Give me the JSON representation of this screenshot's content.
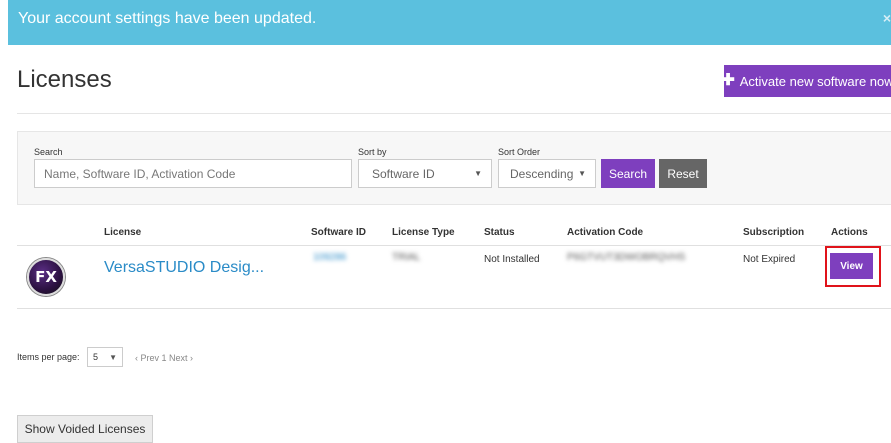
{
  "alert": {
    "message": "Your account settings have been updated.",
    "close_glyph": "×"
  },
  "page": {
    "title": "Licenses"
  },
  "actions": {
    "activate_label": "Activate new software now",
    "activate_icon": "plus-icon"
  },
  "filters": {
    "search_label": "Search",
    "search_placeholder": "Name, Software ID, Activation Code",
    "sort_by_label": "Sort by",
    "sort_by_value": "Software ID",
    "sort_order_label": "Sort Order",
    "sort_order_value": "Descending",
    "search_button": "Search",
    "reset_button": "Reset"
  },
  "table": {
    "columns": [
      "License",
      "Software ID",
      "License Type",
      "Status",
      "Activation Code",
      "Subscription",
      "Actions"
    ],
    "rows": [
      {
        "logo_text": "FX",
        "license": "VersaSTUDIO Desig...",
        "software_id": "109286",
        "license_type": "TRIAL",
        "status": "Not Installed",
        "activation_code": "P6GTVUT3DWOBRQVHS",
        "subscription": "Not Expired",
        "action": "View"
      }
    ]
  },
  "pagination": {
    "items_per_page_label": "Items per page:",
    "items_per_page_value": "5",
    "pager_text": "‹ Prev 1 Next ›"
  },
  "footer": {
    "voided_button": "Show Voided Licenses"
  },
  "colors": {
    "alert_bg": "#5bc0de",
    "primary_purple": "#7e3fbe",
    "reset_gray": "#666666",
    "link_blue": "#2a8bc7",
    "highlight_red": "#e0131a"
  }
}
